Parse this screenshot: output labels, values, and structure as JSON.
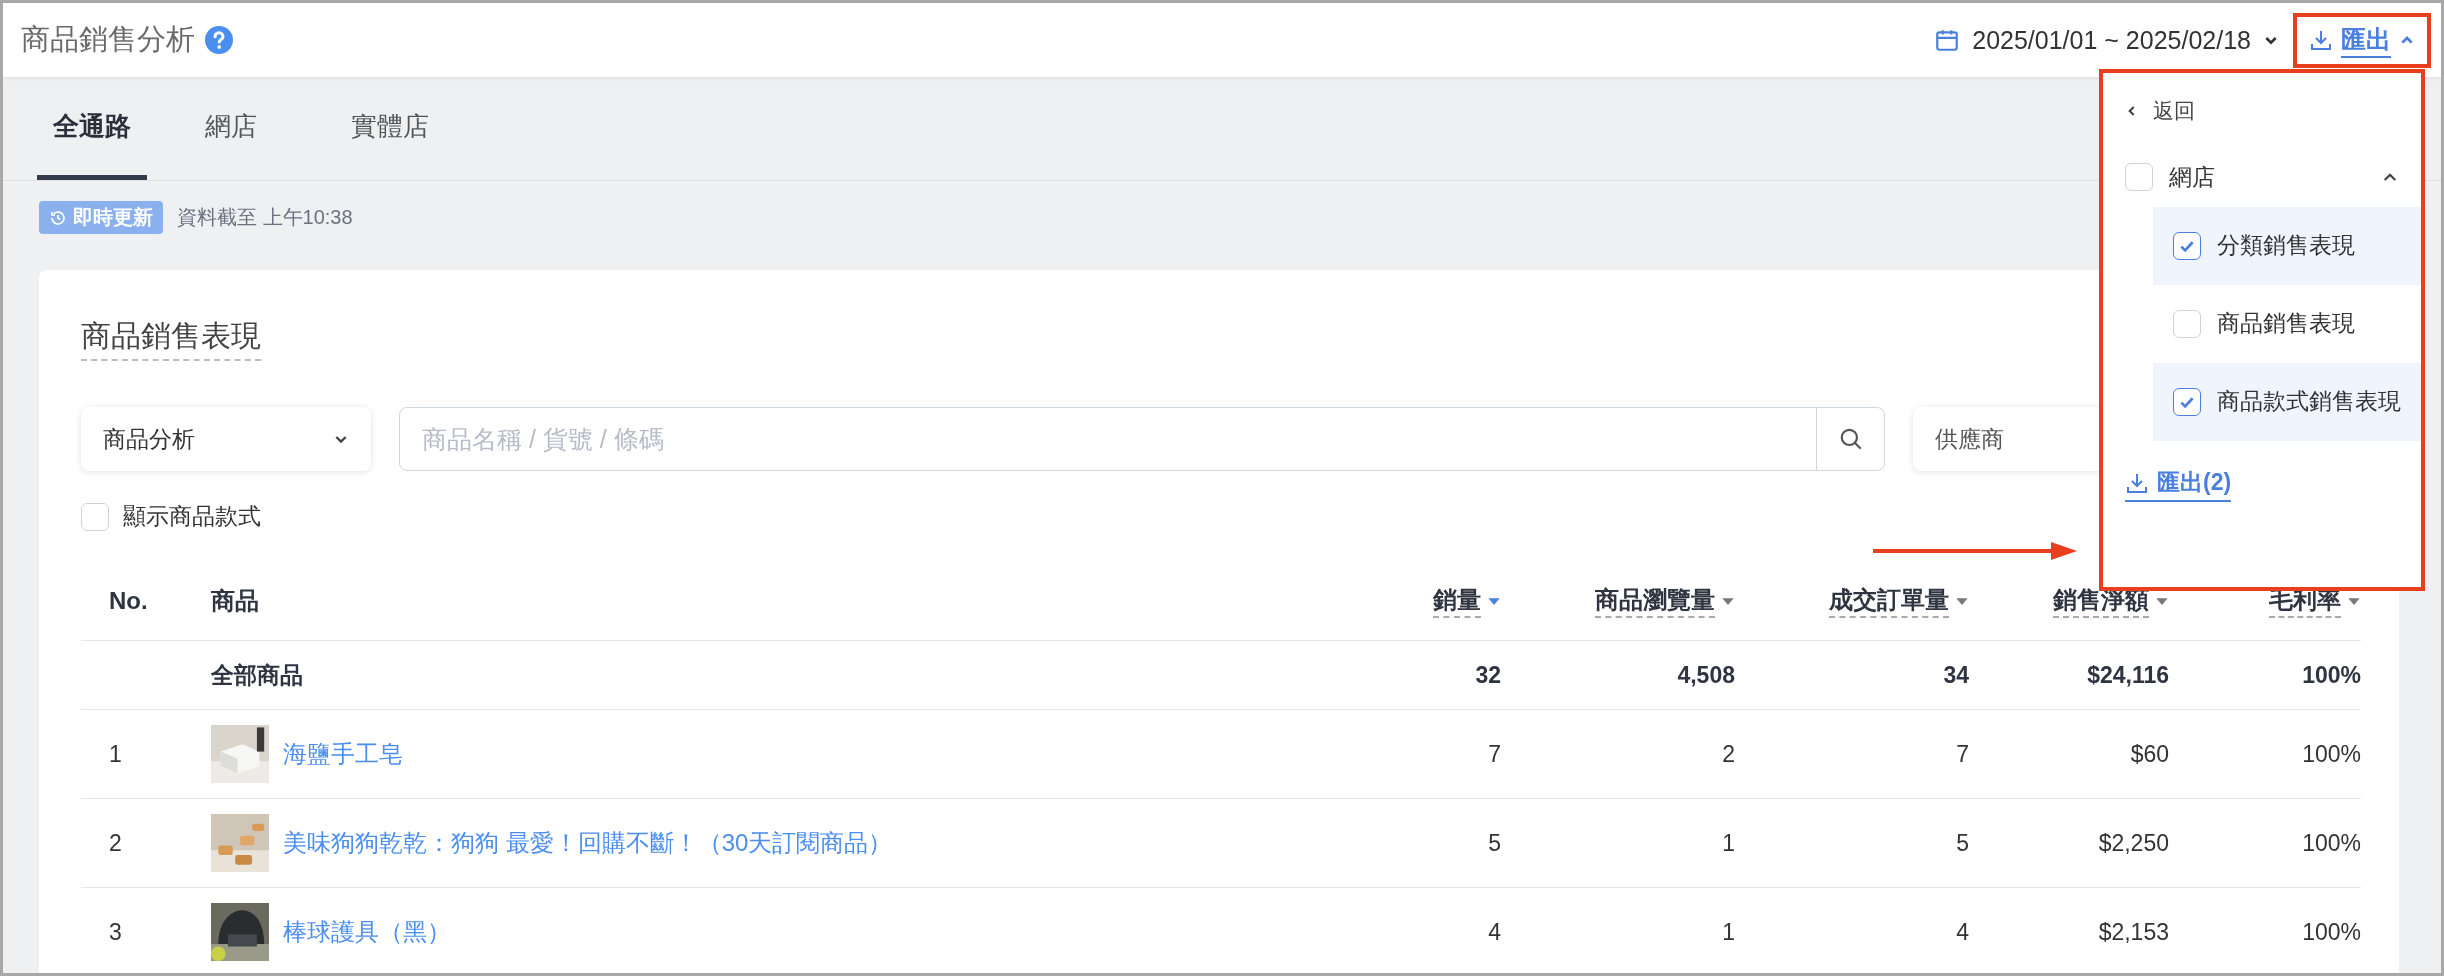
{
  "header": {
    "title": "商品銷售分析",
    "date_range": "2025/01/01 ~ 2025/02/18",
    "export_label": "匯出"
  },
  "tabs": [
    {
      "label": "全通路",
      "selected": true
    },
    {
      "label": "網店",
      "selected": false
    },
    {
      "label": "實體店",
      "selected": false
    }
  ],
  "update": {
    "badge": "即時更新",
    "note": "資料截至 上午10:38"
  },
  "card": {
    "title": "商品銷售表現",
    "analysis_select": "商品分析",
    "search": {
      "placeholder": "商品名稱 / 貨號 / 條碼"
    },
    "supplier_select": "供應商",
    "show_variants": {
      "label": "顯示商品款式",
      "checked": false
    }
  },
  "table": {
    "columns": [
      {
        "label": "No.",
        "kind": "plain"
      },
      {
        "label": "商品",
        "kind": "plain"
      },
      {
        "label": "銷量",
        "kind": "sortable",
        "sorted": true
      },
      {
        "label": "商品瀏覽量",
        "kind": "sortable",
        "sorted": false
      },
      {
        "label": "成交訂單量",
        "kind": "sortable",
        "sorted": false
      },
      {
        "label": "銷售淨額",
        "kind": "sortable",
        "sorted": false
      },
      {
        "label": "毛利率",
        "kind": "sortable",
        "sorted": false
      }
    ],
    "total": {
      "label": "全部商品",
      "values": [
        "32",
        "4,508",
        "34",
        "$24,116",
        "100%"
      ]
    },
    "rows": [
      {
        "no": "1",
        "name": "海鹽手工皂",
        "values": [
          "7",
          "2",
          "7",
          "$60",
          "100%"
        ]
      },
      {
        "no": "2",
        "name": "美味狗狗乾乾：狗狗 最愛！回購不斷！（30天訂閱商品）",
        "values": [
          "5",
          "1",
          "5",
          "$2,250",
          "100%"
        ]
      },
      {
        "no": "3",
        "name": "棒球護具（黑）",
        "values": [
          "4",
          "1",
          "4",
          "$2,153",
          "100%"
        ]
      }
    ]
  },
  "export_menu": {
    "back": "返回",
    "group": {
      "label": "網店",
      "checked": false,
      "expanded": true,
      "children": [
        {
          "label": "分類銷售表現",
          "checked": true
        },
        {
          "label": "商品銷售表現",
          "checked": false
        },
        {
          "label": "商品款式銷售表現",
          "checked": true
        }
      ]
    },
    "submit": "匯出(2)"
  }
}
